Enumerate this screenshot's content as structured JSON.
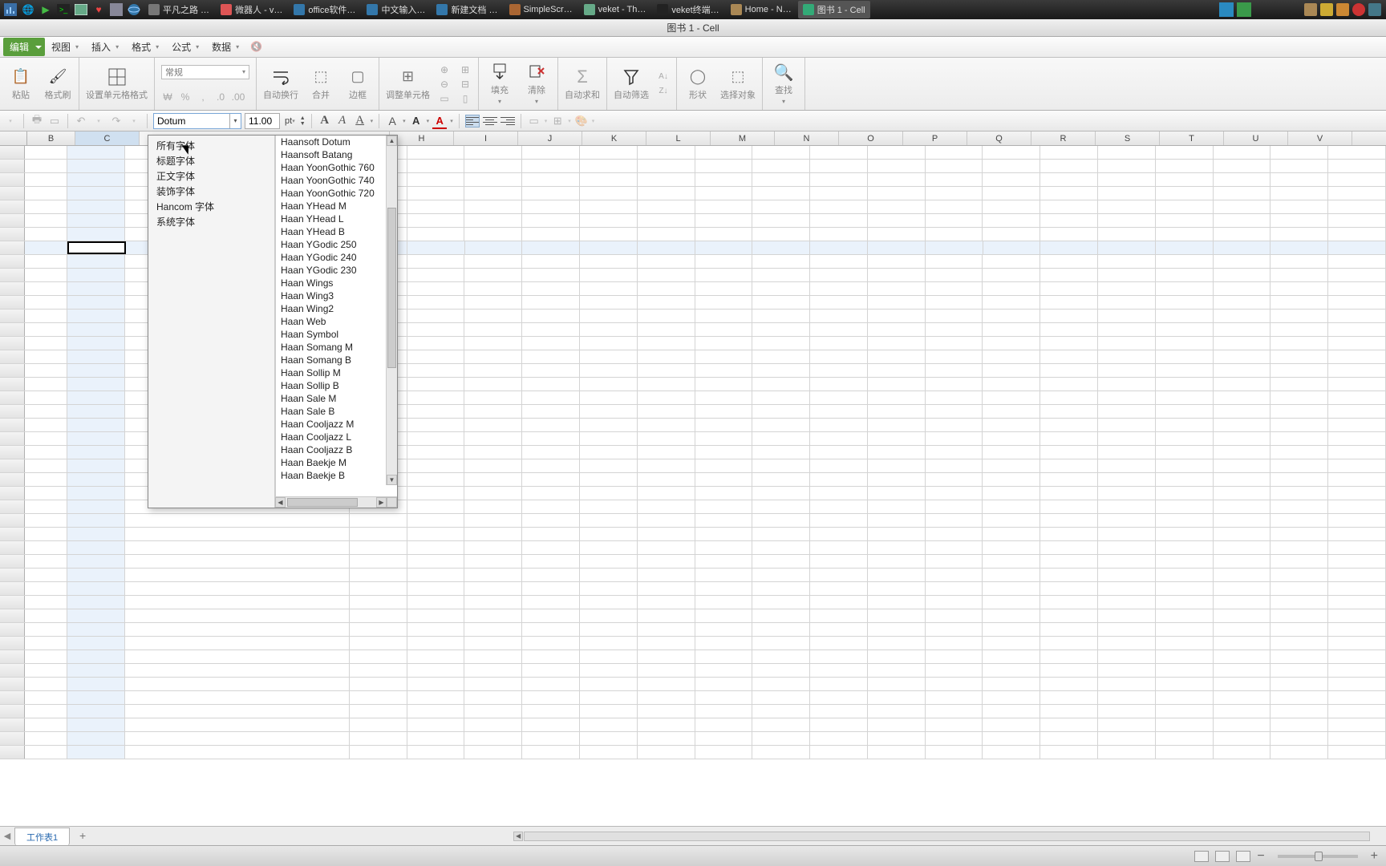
{
  "taskbar": {
    "items": [
      {
        "label": "平凡之路 …"
      },
      {
        "label": "微器人 - v…"
      },
      {
        "label": "office软件…"
      },
      {
        "label": "中文输入…"
      },
      {
        "label": "新建文档 …"
      },
      {
        "label": "SimpleScr…"
      },
      {
        "label": "veket - Th…"
      },
      {
        "label": "veket终端…"
      },
      {
        "label": "Home - N…"
      },
      {
        "label": "图书 1 - Cell",
        "active": true
      }
    ]
  },
  "titlebar": {
    "title": "图书 1 - Cell"
  },
  "menubar": {
    "items": [
      "编辑",
      "视图",
      "插入",
      "格式",
      "公式",
      "数据"
    ]
  },
  "ribbon": {
    "paste": "粘贴",
    "brush": "格式刷",
    "cellfmt": "设置单元格格式",
    "numfmt": "常规",
    "wrap": "自动换行",
    "merge": "合并",
    "border": "边框",
    "adjcell": "调整单元格",
    "fill": "填充",
    "clear": "清除",
    "autosum": "自动求和",
    "autofilter": "自动筛选",
    "shape": "形状",
    "selobj": "选择对象",
    "find": "查找"
  },
  "fontbar": {
    "font_name": "Dotum",
    "font_size": "11.00",
    "font_unit": "pt"
  },
  "font_panel": {
    "categories": [
      "所有字体",
      "标题字体",
      "正文字体",
      "装饰字体",
      "Hancom 字体",
      "系统字体"
    ],
    "fonts": [
      "Haan Baekje B",
      "Haan Baekje M",
      "Haan Cooljazz B",
      "Haan Cooljazz L",
      "Haan Cooljazz M",
      "Haan Sale B",
      "Haan Sale M",
      "Haan Sollip B",
      "Haan Sollip M",
      "Haan Somang B",
      "Haan Somang M",
      "Haan Symbol",
      "Haan Web",
      "Haan Wing2",
      "Haan Wing3",
      "Haan Wings",
      "Haan YGodic 230",
      "Haan YGodic 240",
      "Haan YGodic 250",
      "Haan YHead B",
      "Haan YHead L",
      "Haan YHead M",
      "Haan YoonGothic 720",
      "Haan YoonGothic 740",
      "Haan YoonGothic 760",
      "Haansoft Batang",
      "Haansoft Dotum"
    ]
  },
  "columns": [
    "B",
    "C",
    "",
    "",
    "",
    "",
    "H",
    "I",
    "J",
    "K",
    "L",
    "M",
    "N",
    "O",
    "P",
    "Q",
    "R",
    "S",
    "T",
    "U",
    "V"
  ],
  "sheet_tab": {
    "name": "工作表1"
  },
  "active_cell": {
    "col": "C",
    "row": 8
  }
}
